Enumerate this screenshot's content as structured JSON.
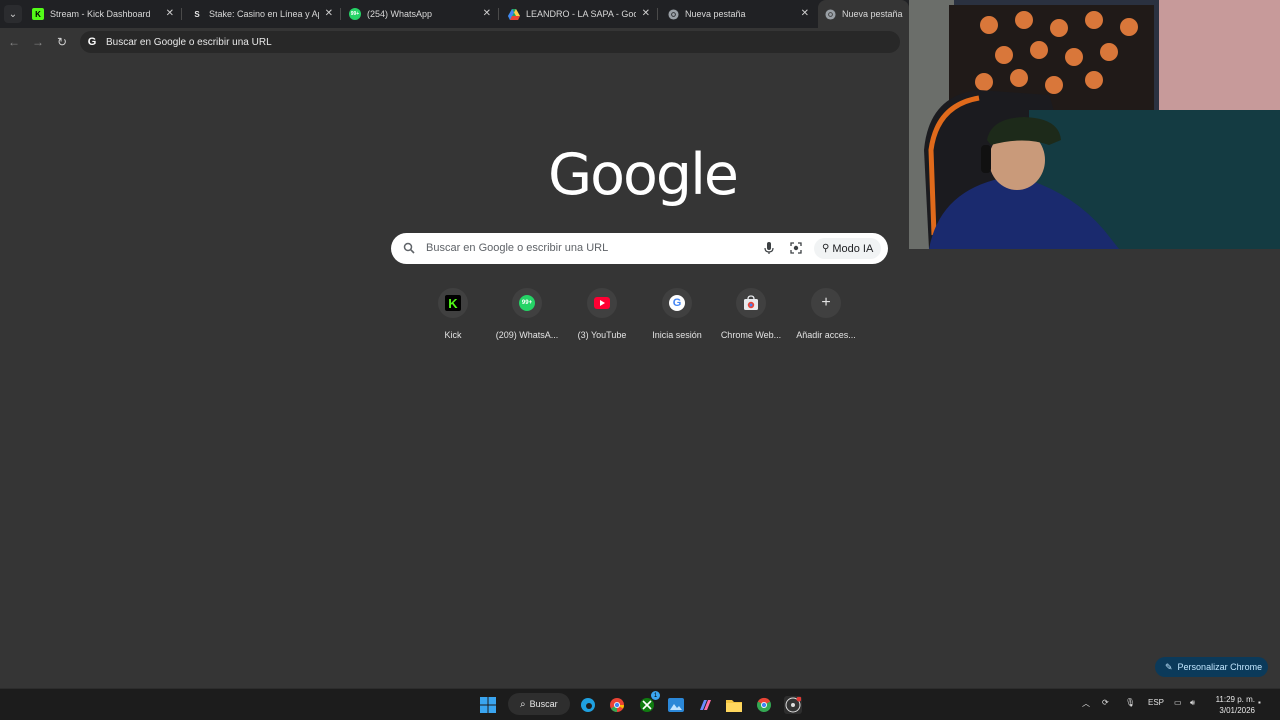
{
  "tabs": [
    {
      "title": "Stream - Kick Dashboard",
      "icon": "kick-icon"
    },
    {
      "title": "Stake: Casino en Línea y Apuest",
      "icon": "stake-icon"
    },
    {
      "title": "(254) WhatsApp",
      "icon": "whatsapp-icon"
    },
    {
      "title": "LEANDRO - LA SAPA - Google D",
      "icon": "google-drive-icon"
    },
    {
      "title": "Nueva pestaña",
      "icon": "chrome-icon"
    },
    {
      "title": "Nueva pestaña",
      "icon": "chrome-icon"
    }
  ],
  "omnibox": {
    "text": "Buscar en Google o escribir una URL"
  },
  "logo": {
    "text": "Google"
  },
  "search": {
    "placeholder": "Buscar en Google o escribir una URL",
    "ai_mode_label": "Modo IA"
  },
  "shortcuts": [
    {
      "label": "Kick",
      "icon": "kick-icon"
    },
    {
      "label": "(209) WhatsA...",
      "icon": "whatsapp-icon",
      "badge": "99+"
    },
    {
      "label": "(3) YouTube",
      "icon": "youtube-icon"
    },
    {
      "label": "Inicia sesión",
      "icon": "google-icon"
    },
    {
      "label": "Chrome Web...",
      "icon": "chrome-web-store-icon"
    },
    {
      "label": "Añadir acces...",
      "icon": "plus-icon"
    }
  ],
  "customize": {
    "label": "Personalizar Chrome"
  },
  "taskbar": {
    "search_label": "Buscar",
    "language": "ESP",
    "time": "11:29 p. m.",
    "date": "3/01/2026",
    "xbox_badge": "1"
  },
  "colors": {
    "background": "#353535",
    "tabstrip": "#202124",
    "kick_green": "#53fc18",
    "whatsapp_green": "#25d366",
    "youtube_red": "#ff0033",
    "customize_bg": "#0b3a5a"
  }
}
